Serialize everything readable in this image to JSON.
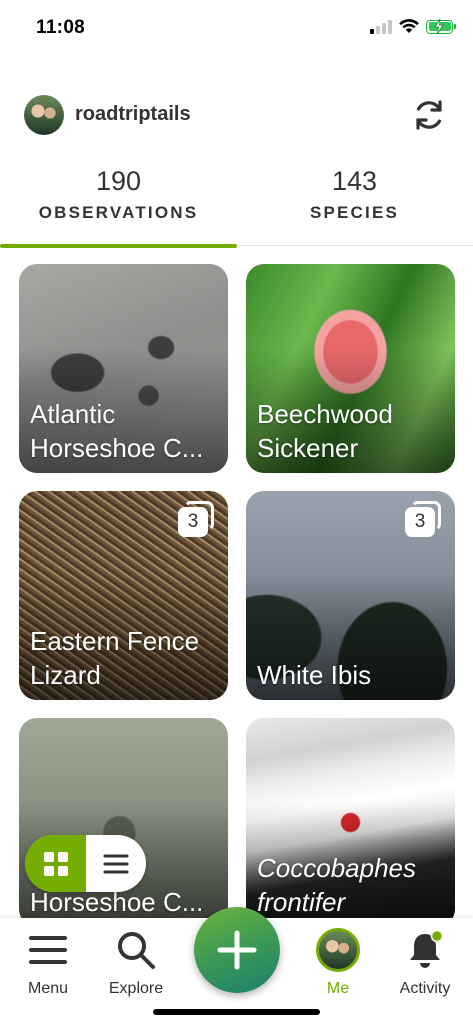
{
  "status_bar": {
    "time": "11:08"
  },
  "header": {
    "username": "roadtriptails",
    "refresh_icon": "refresh-icon"
  },
  "stats": {
    "observations": {
      "count": "190",
      "label": "OBSERVATIONS",
      "active": true
    },
    "species": {
      "count": "143",
      "label": "SPECIES",
      "active": false
    }
  },
  "observations": [
    {
      "name": "Atlantic\nHorseshoe C...",
      "photos": "",
      "italic": false
    },
    {
      "name": "Beechwood\nSickener",
      "photos": "",
      "italic": false
    },
    {
      "name": "Eastern Fence\nLizard",
      "photos": "3",
      "italic": false
    },
    {
      "name": "White Ibis",
      "photos": "3",
      "italic": false
    },
    {
      "name": "Horseshoe C...",
      "photos": "",
      "italic": false
    },
    {
      "name": "Coccobaphes\nfrontifer",
      "photos": "",
      "italic": true
    }
  ],
  "view_toggle": {
    "selected": "grid"
  },
  "tab_bar": {
    "menu": "Menu",
    "explore": "Explore",
    "me": "Me",
    "activity": "Activity"
  },
  "colors": {
    "accent": "#74ac00",
    "fab_start": "#6cb33b",
    "fab_end": "#1d7e6e"
  }
}
